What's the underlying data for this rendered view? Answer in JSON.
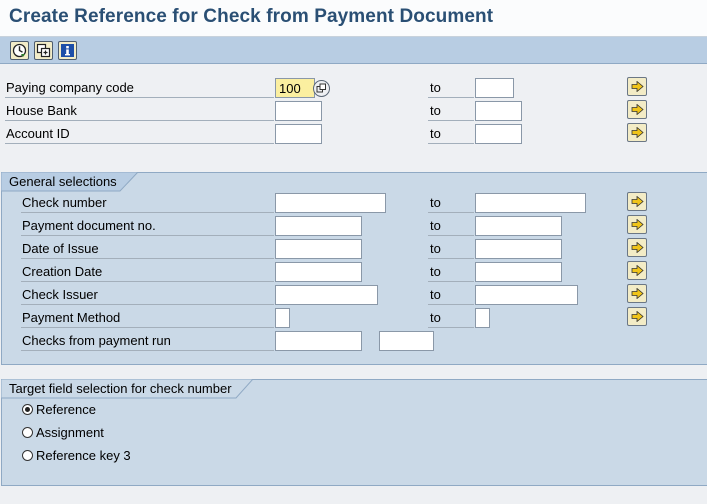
{
  "title": "Create Reference for Check from Payment Document",
  "toolbar": {
    "buttons": [
      {
        "name": "execute-icon"
      },
      {
        "name": "get-variant-icon"
      },
      {
        "name": "info-icon"
      }
    ]
  },
  "header_fields": {
    "to_label": "to",
    "paying_company_code": {
      "label": "Paying company code",
      "value": "100"
    },
    "house_bank": {
      "label": "House Bank",
      "value": ""
    },
    "account_id": {
      "label": "Account ID",
      "value": ""
    }
  },
  "general_selections": {
    "title": "General selections",
    "check_number": {
      "label": "Check number"
    },
    "payment_document_no": {
      "label": "Payment document no."
    },
    "date_of_issue": {
      "label": "Date of Issue"
    },
    "creation_date": {
      "label": "Creation Date"
    },
    "check_issuer": {
      "label": "Check Issuer"
    },
    "payment_method": {
      "label": "Payment Method"
    },
    "checks_from_payment_run": {
      "label": "Checks from payment run"
    }
  },
  "target_field": {
    "title": "Target field selection for check number",
    "options": [
      {
        "label": "Reference",
        "selected": true
      },
      {
        "label": "Assignment",
        "selected": false
      },
      {
        "label": "Reference key 3",
        "selected": false
      }
    ]
  },
  "colors": {
    "title_text": "#2a4f74",
    "toolbar_bg": "#b8cde3",
    "group_bg": "#cad9e7",
    "required_field_bg": "#fbefa0"
  }
}
